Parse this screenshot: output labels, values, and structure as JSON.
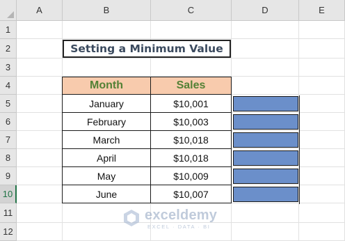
{
  "spreadsheet": {
    "columns": [
      "A",
      "B",
      "C",
      "D",
      "E"
    ],
    "rows": [
      "1",
      "2",
      "3",
      "4",
      "5",
      "6",
      "7",
      "8",
      "9",
      "10",
      "11",
      "12"
    ]
  },
  "title": "Setting a Minimum Value",
  "table": {
    "headers": {
      "month": "Month",
      "sales": "Sales"
    },
    "rows": [
      {
        "month": "January",
        "sales": "$10,001"
      },
      {
        "month": "February",
        "sales": "$10,003"
      },
      {
        "month": "March",
        "sales": "$10,018"
      },
      {
        "month": "April",
        "sales": "$10,018"
      },
      {
        "month": "May",
        "sales": "$10,009"
      },
      {
        "month": "June",
        "sales": "$10,007"
      }
    ]
  },
  "data_bar_fill_percent": [
    100,
    100,
    100,
    100,
    100,
    100
  ],
  "colors": {
    "header_fill": "#f8cbad",
    "header_text": "#538135",
    "data_bar": "#6b8fca",
    "title_text": "#3b4a5e"
  },
  "watermark": {
    "name": "exceldemy",
    "tagline": "EXCEL · DATA · BI",
    "icon": "exceldemy-logo-icon"
  }
}
